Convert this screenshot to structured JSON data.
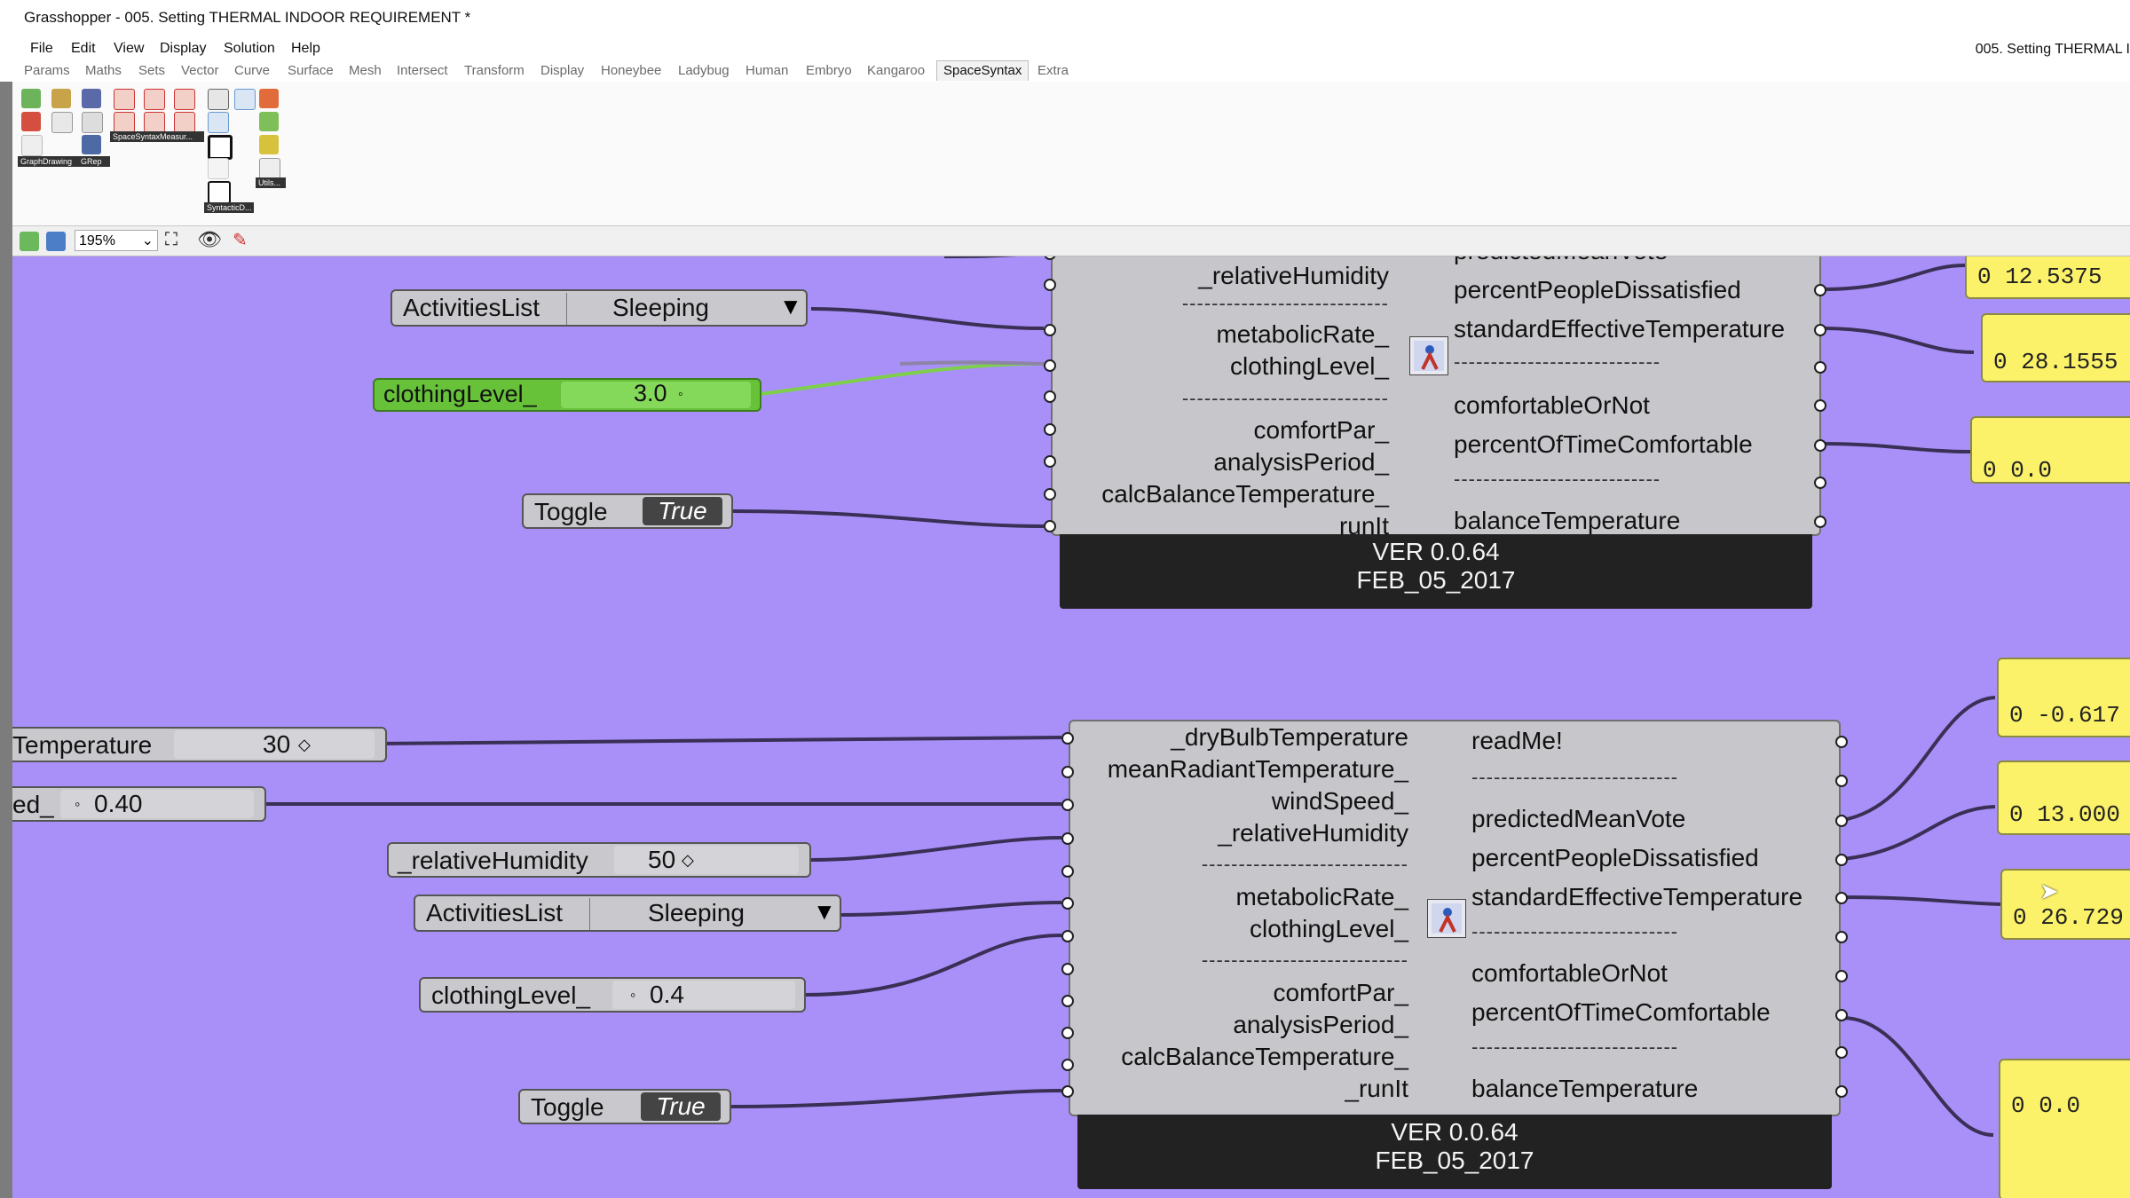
{
  "window": {
    "title": "Grasshopper - 005. Setting THERMAL INDOOR REQUIREMENT *",
    "doc_title_right": "005. Setting THERMAL I"
  },
  "menu": [
    "File",
    "Edit",
    "View",
    "Display",
    "Solution",
    "Help"
  ],
  "tabs": [
    "Params",
    "Maths",
    "Sets",
    "Vector",
    "Curve",
    "Surface",
    "Mesh",
    "Intersect",
    "Transform",
    "Display",
    "Honeybee",
    "Ladybug",
    "Human",
    "Embryo",
    "Kangaroo",
    "SpaceSyntax",
    "Extra"
  ],
  "active_tab": "SpaceSyntax",
  "ribbon_groups": {
    "g1": "GraphDrawing",
    "g2": "GRep",
    "g3": "SpaceSyntaxMeasur...",
    "g4": "SyntacticD...",
    "g5": "Utils..."
  },
  "canvas_toolbar": {
    "zoom": "195%"
  },
  "top_component": {
    "inputs": [
      "_relativeHumidity",
      "----------------------------",
      "metabolicRate_",
      "clothingLevel_",
      "----------------------------",
      "comfortPar_",
      "analysisPeriod_",
      "calcBalanceTemperature_",
      "_runIt"
    ],
    "outputs": [
      "predictedMeanVote",
      "percentPeopleDissatisfied",
      "standardEffectiveTemperature",
      "----------------------------",
      "comfortableOrNot",
      "percentOfTimeComfortable",
      "----------------------------",
      "balanceTemperature"
    ],
    "version": "VER 0.0.64",
    "date": "FEB_05_2017"
  },
  "bottom_component": {
    "inputs": [
      "_dryBulbTemperature",
      "meanRadiantTemperature_",
      "windSpeed_",
      "_relativeHumidity",
      "----------------------------",
      "metabolicRate_",
      "clothingLevel_",
      "----------------------------",
      "comfortPar_",
      "analysisPeriod_",
      "calcBalanceTemperature_",
      "_runIt"
    ],
    "outputs": [
      "readMe!",
      "----------------------------",
      "predictedMeanVote",
      "percentPeopleDissatisfied",
      "standardEffectiveTemperature",
      "----------------------------",
      "comfortableOrNot",
      "percentOfTimeComfortable",
      "----------------------------",
      "balanceTemperature"
    ],
    "version": "VER 0.0.64",
    "date": "FEB_05_2017"
  },
  "widgets": {
    "activities_top": {
      "label": "ActivitiesList",
      "value": "Sleeping"
    },
    "clothing_top": {
      "label": "clothingLevel_",
      "value": "3.0"
    },
    "toggle_top": {
      "label": "Toggle",
      "value": "True"
    },
    "temperature": {
      "label": "Temperature",
      "value": "30"
    },
    "windspeed": {
      "label": "ed_",
      "value": "0.40"
    },
    "humidity": {
      "label": "_relativeHumidity",
      "value": "50"
    },
    "activities_bottom": {
      "label": "ActivitiesList",
      "value": "Sleeping"
    },
    "clothing_bottom": {
      "label": "clothingLevel_",
      "value": "0.4"
    },
    "toggle_bottom": {
      "label": "Toggle",
      "value": "True"
    }
  },
  "panels": {
    "p1": "0 12.5375",
    "p2": "0 28.1555",
    "p3": "0 0.0",
    "p4": "0 -0.617",
    "p5": "0 13.000",
    "p6": "0 26.729",
    "p7": "0 0.0"
  },
  "colors": {
    "canvas": "#a990f9",
    "component": "#c7c7cb",
    "panel": "#fbf26a",
    "selected_slider": "#6fcf3a"
  }
}
